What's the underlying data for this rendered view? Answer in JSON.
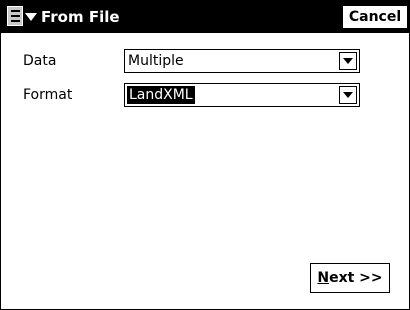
{
  "window": {
    "title": "From File"
  },
  "titlebar": {
    "cancel_label": "Cancel",
    "menu_icon": "start-menu-icon"
  },
  "form": {
    "data_label": "Data",
    "data_value": "Multiple",
    "format_label": "Format",
    "format_value": "LandXML"
  },
  "footer": {
    "next_mnemonic": "N",
    "next_rest": "ext >>"
  }
}
